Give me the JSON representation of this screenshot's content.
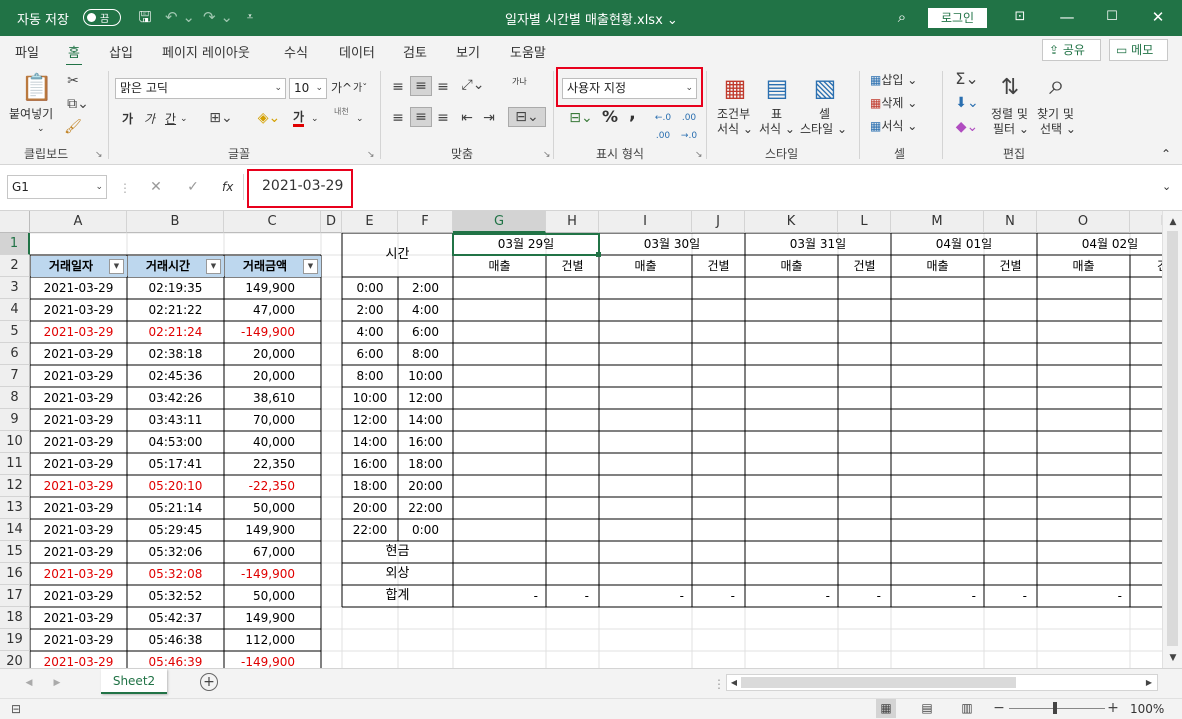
{
  "titlebar": {
    "autosave": "자동 저장",
    "toggle": "끔",
    "filename": "일자별 시간별 매출현황.xlsx",
    "filename_arrow": "⌄",
    "login": "로그인"
  },
  "menu": {
    "tabs": [
      "파일",
      "홈",
      "삽입",
      "페이지 레이아웃",
      "수식",
      "데이터",
      "검토",
      "보기",
      "도움말"
    ],
    "share": "공유",
    "comment": "메모"
  },
  "ribbon": {
    "clipboard": {
      "paste": "붙여넣기",
      "label": "클립보드"
    },
    "font": {
      "name": "맑은 고딕",
      "size": "10",
      "bold": "가",
      "italic": "가",
      "underline": "간",
      "color_glyph": "가",
      "label": "글꼴",
      "grow": "가",
      "shrink": "가",
      "phonetic": "내천"
    },
    "align": {
      "label": "맞춤",
      "wrap": "가나"
    },
    "number": {
      "format": "사용자 지정",
      "label": "표시 형식",
      "percent": "%",
      "comma": ","
    },
    "styles": {
      "cond": "조건부",
      "cond2": "서식",
      "table": "표",
      "table2": "서식",
      "cell": "셀",
      "cell2": "스타일",
      "label": "스타일"
    },
    "cells": {
      "insert": "삽입",
      "delete": "삭제",
      "format": "서식",
      "label": "셀"
    },
    "edit": {
      "sort": "정렬 및",
      "sort2": "필터",
      "find": "찾기 및",
      "find2": "선택",
      "label": "편집"
    }
  },
  "formula": {
    "namebox": "G1",
    "fx": "fx",
    "value": "2021-03-29"
  },
  "columns": [
    "A",
    "B",
    "C",
    "D",
    "E",
    "F",
    "G",
    "H",
    "I",
    "J",
    "K",
    "L",
    "M",
    "N",
    "O",
    "P"
  ],
  "rows": [
    "1",
    "2",
    "3",
    "4",
    "5",
    "6",
    "7",
    "8",
    "9",
    "10",
    "11",
    "12",
    "13",
    "14",
    "15",
    "16",
    "17",
    "18",
    "19",
    "20"
  ],
  "table": {
    "headers": [
      "거래일자",
      "거래시간",
      "거래금액"
    ],
    "data": [
      [
        "2021-03-29",
        "02:19:35",
        "149,900",
        false
      ],
      [
        "2021-03-29",
        "02:21:22",
        "47,000",
        false
      ],
      [
        "2021-03-29",
        "02:21:24",
        "-149,900",
        true
      ],
      [
        "2021-03-29",
        "02:38:18",
        "20,000",
        false
      ],
      [
        "2021-03-29",
        "02:45:36",
        "20,000",
        false
      ],
      [
        "2021-03-29",
        "03:42:26",
        "38,610",
        false
      ],
      [
        "2021-03-29",
        "03:43:11",
        "70,000",
        false
      ],
      [
        "2021-03-29",
        "04:53:00",
        "40,000",
        false
      ],
      [
        "2021-03-29",
        "05:17:41",
        "22,350",
        false
      ],
      [
        "2021-03-29",
        "05:20:10",
        "-22,350",
        true
      ],
      [
        "2021-03-29",
        "05:21:14",
        "50,000",
        false
      ],
      [
        "2021-03-29",
        "05:29:45",
        "149,900",
        false
      ],
      [
        "2021-03-29",
        "05:32:06",
        "67,000",
        false
      ],
      [
        "2021-03-29",
        "05:32:08",
        "-149,900",
        true
      ],
      [
        "2021-03-29",
        "05:32:52",
        "50,000",
        false
      ],
      [
        "2021-03-29",
        "05:42:37",
        "149,900",
        false
      ],
      [
        "2021-03-29",
        "05:46:38",
        "112,000",
        false
      ],
      [
        "2021-03-29",
        "05:46:39",
        "-149,900",
        true
      ]
    ]
  },
  "summary": {
    "time_label": "시간",
    "slots": [
      [
        "0:00",
        "2:00"
      ],
      [
        "2:00",
        "4:00"
      ],
      [
        "4:00",
        "6:00"
      ],
      [
        "6:00",
        "8:00"
      ],
      [
        "8:00",
        "10:00"
      ],
      [
        "10:00",
        "12:00"
      ],
      [
        "12:00",
        "14:00"
      ],
      [
        "14:00",
        "16:00"
      ],
      [
        "16:00",
        "18:00"
      ],
      [
        "18:00",
        "20:00"
      ],
      [
        "20:00",
        "22:00"
      ],
      [
        "22:00",
        "0:00"
      ]
    ],
    "cash": "현금",
    "credit": "외상",
    "total": "합계",
    "dates": [
      "03월 29일",
      "03월 30일",
      "03월 31일",
      "04월 01일",
      "04월 02일"
    ],
    "sales": "매출",
    "count": "건별",
    "dash": "-",
    "count_trunc": "건"
  },
  "sheet": {
    "tab": "Sheet2",
    "add": "+"
  },
  "status": {
    "zoom": "100%"
  }
}
